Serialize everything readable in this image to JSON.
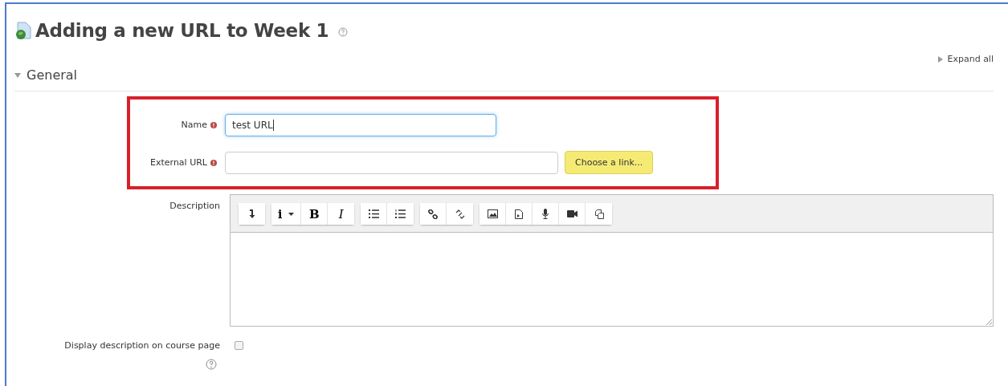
{
  "page": {
    "title": "Adding a new URL to Week 1"
  },
  "expand_all": "Expand all",
  "section": {
    "title": "General",
    "expanded": true
  },
  "name_field": {
    "label": "Name",
    "required": true,
    "value": "test URL"
  },
  "url_field": {
    "label": "External URL",
    "required": true,
    "button": "Choose a link..."
  },
  "description": {
    "label": "Description",
    "toolbar": [
      [
        {
          "kind": "collapse"
        }
      ],
      [
        {
          "kind": "dropdown",
          "label": "i"
        },
        {
          "kind": "bold",
          "label": "B"
        },
        {
          "kind": "italic",
          "label": "I"
        }
      ],
      [
        {
          "kind": "bullets"
        },
        {
          "kind": "numbers"
        }
      ],
      [
        {
          "kind": "link"
        },
        {
          "kind": "unlink"
        }
      ],
      [
        {
          "kind": "image"
        },
        {
          "kind": "media"
        },
        {
          "kind": "mic"
        },
        {
          "kind": "video"
        },
        {
          "kind": "paste"
        }
      ]
    ]
  },
  "display_description": {
    "label": "Display description on course page",
    "checked": false
  }
}
